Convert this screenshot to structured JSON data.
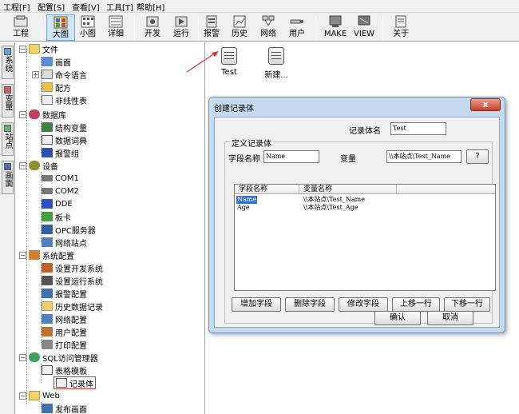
{
  "menu": [
    "工程[F]",
    "配置[S]",
    "查看[V]",
    "工具[T]",
    "帮助[H]"
  ],
  "toolbar": [
    {
      "label": "工程",
      "icon": "project-icon"
    },
    {
      "label": "大图",
      "icon": "large-icons-view-icon"
    },
    {
      "label": "小图",
      "icon": "small-icons-view-icon"
    },
    {
      "label": "详细",
      "icon": "detail-view-icon"
    },
    {
      "label": "开发",
      "icon": "develop-icon"
    },
    {
      "label": "运行",
      "icon": "run-icon"
    },
    {
      "label": "报警",
      "icon": "alarm-icon"
    },
    {
      "label": "历史",
      "icon": "history-icon"
    },
    {
      "label": "网络",
      "icon": "network-icon"
    },
    {
      "label": "用户",
      "icon": "user-icon"
    },
    {
      "label": "MAKE",
      "icon": "make-icon"
    },
    {
      "label": "VIEW",
      "icon": "view-icon"
    },
    {
      "label": "关于",
      "icon": "about-icon"
    }
  ],
  "side_tabs": [
    "系统",
    "变量",
    "站点",
    "画面"
  ],
  "tree": [
    {
      "label": "文件",
      "level": 0
    },
    {
      "label": "画面",
      "level": 1
    },
    {
      "label": "命令语言",
      "level": 1
    },
    {
      "label": "配方",
      "level": 1
    },
    {
      "label": "非线性表",
      "level": 1
    },
    {
      "label": "数据库",
      "level": 0
    },
    {
      "label": "结构变量",
      "level": 1
    },
    {
      "label": "数据词典",
      "level": 1
    },
    {
      "label": "报警组",
      "level": 1
    },
    {
      "label": "设备",
      "level": 0
    },
    {
      "label": "COM1",
      "level": 1
    },
    {
      "label": "COM2",
      "level": 1
    },
    {
      "label": "DDE",
      "level": 1
    },
    {
      "label": "板卡",
      "level": 1
    },
    {
      "label": "OPC服务器",
      "level": 1
    },
    {
      "label": "网络站点",
      "level": 1
    },
    {
      "label": "系统配置",
      "level": 0
    },
    {
      "label": "设置开发系统",
      "level": 1
    },
    {
      "label": "设置运行系统",
      "level": 1
    },
    {
      "label": "报警配置",
      "level": 1
    },
    {
      "label": "历史数据记录",
      "level": 1
    },
    {
      "label": "网络配置",
      "level": 1
    },
    {
      "label": "用户配置",
      "level": 1
    },
    {
      "label": "打印配置",
      "level": 1
    },
    {
      "label": "SQL访问管理器",
      "level": 0
    },
    {
      "label": "表格模板",
      "level": 1
    },
    {
      "label": "记录体",
      "level": 1
    },
    {
      "label": "Web",
      "level": 0
    },
    {
      "label": "发布画面",
      "level": 1
    }
  ],
  "items": [
    "Test",
    "新建..."
  ],
  "dialog": {
    "title": "创建记录体",
    "close": "x",
    "record_name_label": "记录体名",
    "record_name_value": "Test",
    "group_title": "定义记录体",
    "field_name_label": "字段名称",
    "field_name_value": "Name",
    "variable_label": "变量",
    "variable_value": "\\\\本站点\\Test_Name",
    "browse": "?",
    "columns": [
      "字段名称",
      "变量名称"
    ],
    "rows": [
      {
        "field": "Name",
        "var": "\\\\本站点\\Test_Name"
      },
      {
        "field": "Age",
        "var": "\\\\本站点\\Test_Age"
      }
    ],
    "buttons": [
      "增加字段",
      "删除字段",
      "修改字段",
      "上移一行",
      "下移一行"
    ],
    "ok": "确认",
    "cancel": "取消"
  }
}
